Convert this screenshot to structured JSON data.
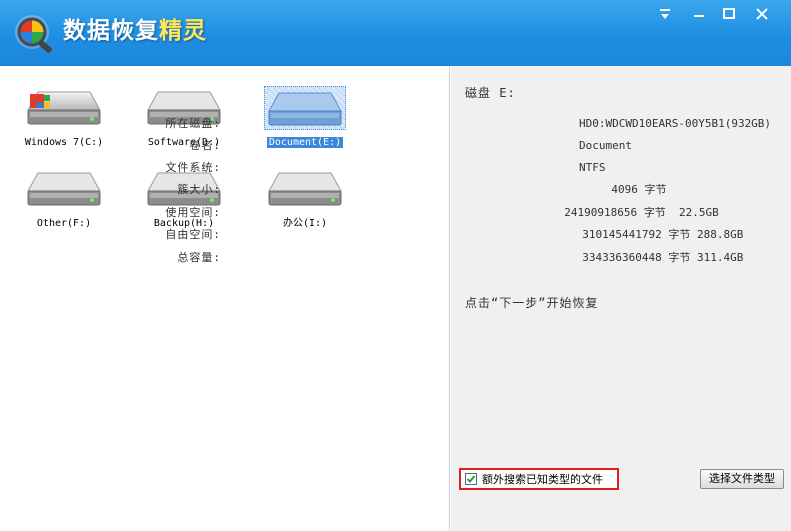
{
  "app": {
    "title_main": "数据恢复",
    "title_accent": "精灵"
  },
  "window_controls": {
    "minimize_icon": "minimize-down-arrow-icon",
    "restore_icon": "minimize-icon",
    "maximize_icon": "maximize-icon",
    "close_icon": "close-icon"
  },
  "drives": [
    {
      "label": "Windows 7(C:)",
      "icon": "windows-hdd-icon",
      "selected": false
    },
    {
      "label": "Software(D:)",
      "icon": "hdd-icon",
      "selected": false
    },
    {
      "label": "Document(E:)",
      "icon": "hdd-icon",
      "selected": true
    },
    {
      "label": "Other(F:)",
      "icon": "hdd-icon",
      "selected": false
    },
    {
      "label": "Backup(H:)",
      "icon": "hdd-icon",
      "selected": false
    },
    {
      "label": "办公(I:)",
      "icon": "hdd-icon",
      "selected": false
    }
  ],
  "info": {
    "disk_title": "磁盘 E:",
    "rows": [
      {
        "label": "所在磁盘:",
        "value": "HD0:WDCWD10EARS-00Y5B1(932GB)"
      },
      {
        "label": "卷名:",
        "value": "Document"
      },
      {
        "label": "文件系统:",
        "value": "NTFS"
      },
      {
        "label": "簇大小:",
        "value": "       4096 字节"
      },
      {
        "label": "使用空间:",
        "value": "  24190918656 字节  22.5GB"
      },
      {
        "label": "自由空间:",
        "value": "  310145441792 字节 288.8GB"
      },
      {
        "label": "总容量:",
        "value": "  334336360448 字节 311.4GB"
      }
    ],
    "hint": "点击“下一步”开始恢复"
  },
  "options": {
    "extra_search_label": "额外搜索已知类型的文件",
    "extra_search_checked": true,
    "select_file_types_label": "选择文件类型"
  },
  "colors": {
    "titlebar": "#1f8fe3",
    "accent_title": "#ffe75a",
    "highlight_border": "#e01e1e",
    "selection": "#3a86d8"
  }
}
